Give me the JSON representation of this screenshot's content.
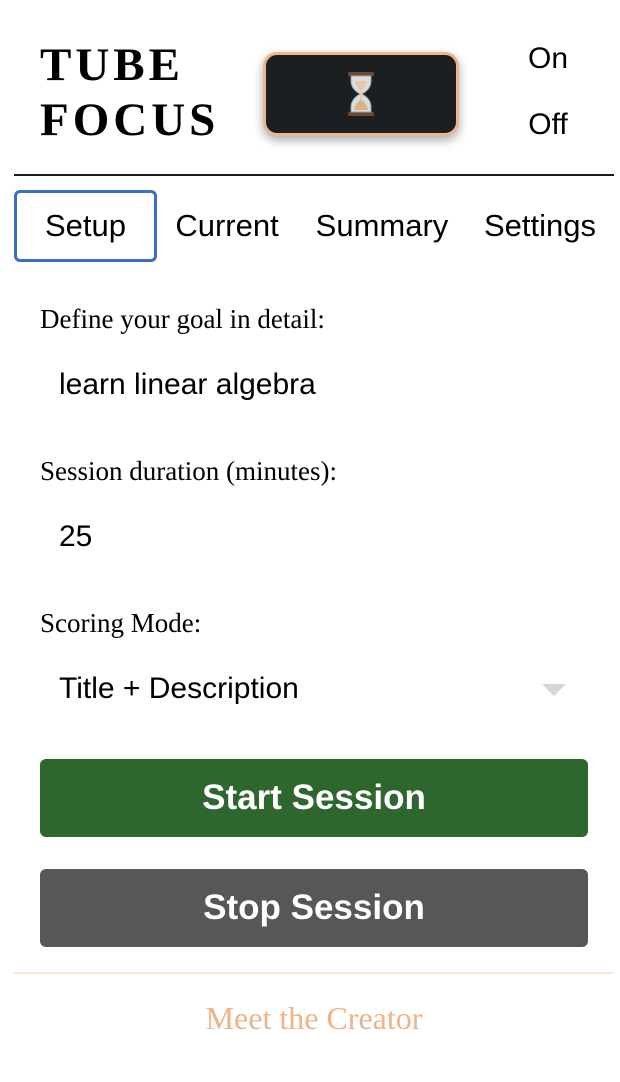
{
  "header": {
    "brand_line1": "TUBE",
    "brand_line2": "FOCUS",
    "toggle_icon": "hourglass-icon",
    "on_label": "On",
    "off_label": "Off"
  },
  "tabs": [
    {
      "label": "Setup",
      "active": true
    },
    {
      "label": "Current",
      "active": false
    },
    {
      "label": "Summary",
      "active": false
    },
    {
      "label": "Settings",
      "active": false
    }
  ],
  "form": {
    "goal_label": "Define your goal in detail:",
    "goal_value": "learn linear algebra",
    "duration_label": "Session duration (minutes):",
    "duration_value": "25",
    "scoring_label": "Scoring Mode:",
    "scoring_value": "Title + Description"
  },
  "actions": {
    "start_label": "Start Session",
    "stop_label": "Stop Session"
  },
  "footer": {
    "creator_link": "Meet the Creator"
  },
  "colors": {
    "active_tab_border": "#3a6fc4",
    "start_button": "#2e672d",
    "stop_button": "#575757",
    "toggle_border": "#f0b48a",
    "creator_link": "#eeb38a"
  }
}
